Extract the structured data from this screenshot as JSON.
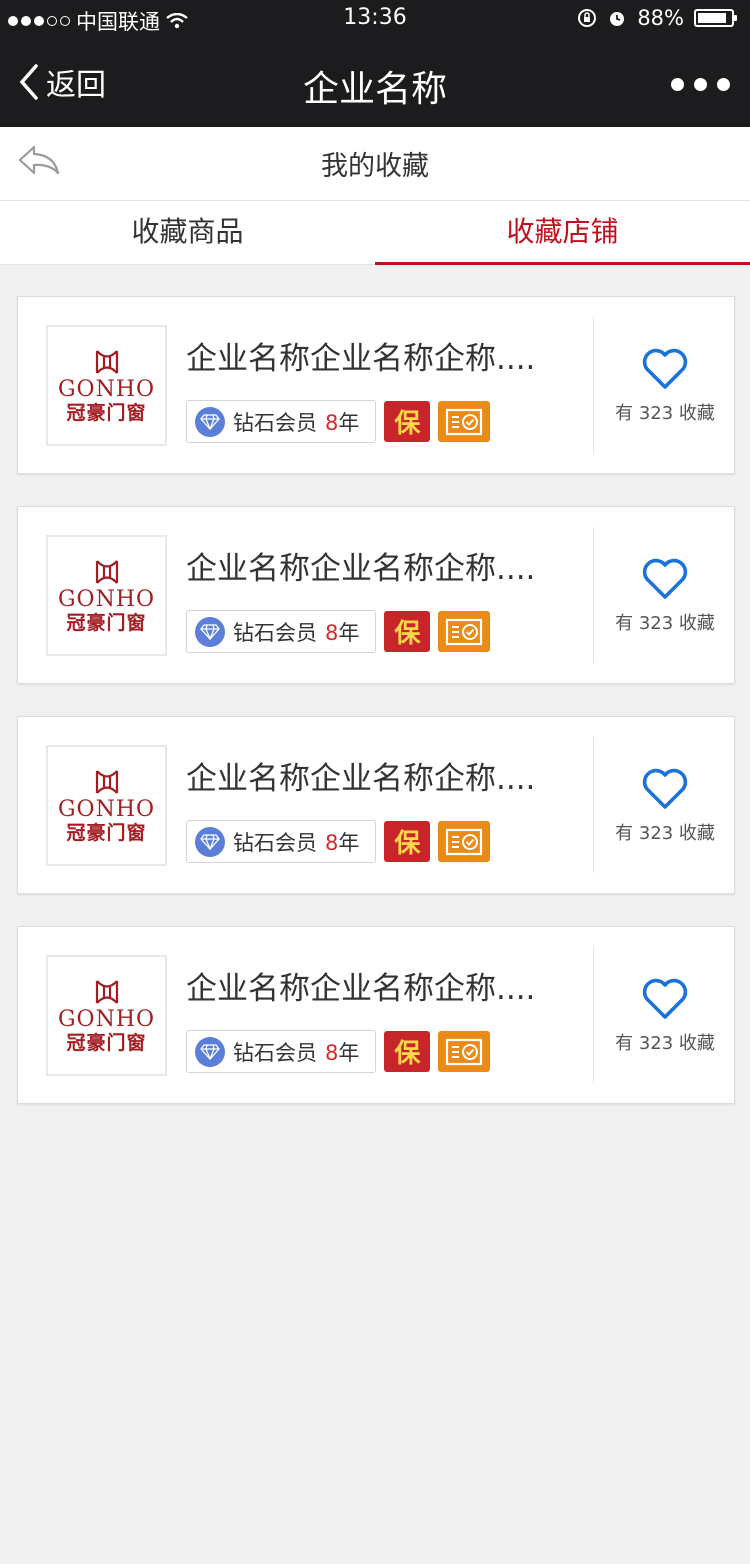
{
  "status_bar": {
    "carrier": "中国联通",
    "time": "13:36",
    "battery": "88%",
    "battery_level": 0.88
  },
  "nav": {
    "back_label": "返回",
    "title": "企业名称"
  },
  "subheader": {
    "title": "我的收藏"
  },
  "tabs": [
    {
      "label": "收藏商品",
      "active": false
    },
    {
      "label": "收藏店铺",
      "active": true
    }
  ],
  "colors": {
    "accent": "#c0111f",
    "heart": "#1a73d8",
    "bao_bg": "#c8252b",
    "cert_bg": "#ea8a17"
  },
  "logo": {
    "en": "GONHO",
    "cn": "冠豪门窗"
  },
  "stores": [
    {
      "name": "企业名称企业名称企称....",
      "member_level": "钻石会员",
      "years_num": "8",
      "years_unit": "年",
      "bao": "保",
      "fav_prefix": "有",
      "fav_count": "323",
      "fav_suffix": "收藏"
    },
    {
      "name": "企业名称企业名称企称....",
      "member_level": "钻石会员",
      "years_num": "8",
      "years_unit": "年",
      "bao": "保",
      "fav_prefix": "有",
      "fav_count": "323",
      "fav_suffix": "收藏"
    },
    {
      "name": "企业名称企业名称企称....",
      "member_level": "钻石会员",
      "years_num": "8",
      "years_unit": "年",
      "bao": "保",
      "fav_prefix": "有",
      "fav_count": "323",
      "fav_suffix": "收藏"
    },
    {
      "name": "企业名称企业名称企称....",
      "member_level": "钻石会员",
      "years_num": "8",
      "years_unit": "年",
      "bao": "保",
      "fav_prefix": "有",
      "fav_count": "323",
      "fav_suffix": "收藏"
    }
  ]
}
